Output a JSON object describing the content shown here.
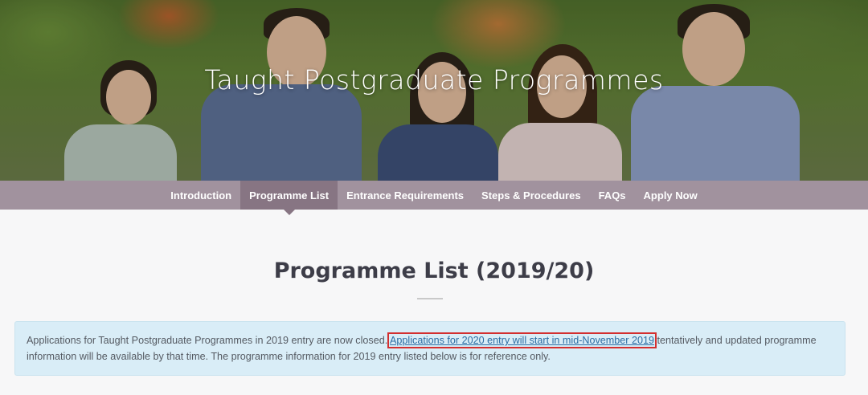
{
  "hero": {
    "title": "Taught Postgraduate Programmes"
  },
  "nav": {
    "items": [
      {
        "label": "Introduction",
        "active": false
      },
      {
        "label": "Programme List",
        "active": true
      },
      {
        "label": "Entrance Requirements",
        "active": false
      },
      {
        "label": "Steps & Procedures",
        "active": false
      },
      {
        "label": "FAQs",
        "active": false
      },
      {
        "label": "Apply Now",
        "active": false
      }
    ]
  },
  "main": {
    "title": "Programme List (2019/20)",
    "notice": {
      "before": "Applications for Taught Postgraduate Programmes in 2019 entry are now closed. ",
      "highlight": "Applications for 2020 entry will start in mid-November 2019",
      "after": " tentatively and updated programme information will be available by that time. The programme information for 2019 entry listed below is for reference only."
    }
  },
  "colors": {
    "nav_bg": "#a1929e",
    "nav_active": "#877583",
    "notice_bg": "#d9edf7",
    "highlight_box": "#d32f2f"
  }
}
